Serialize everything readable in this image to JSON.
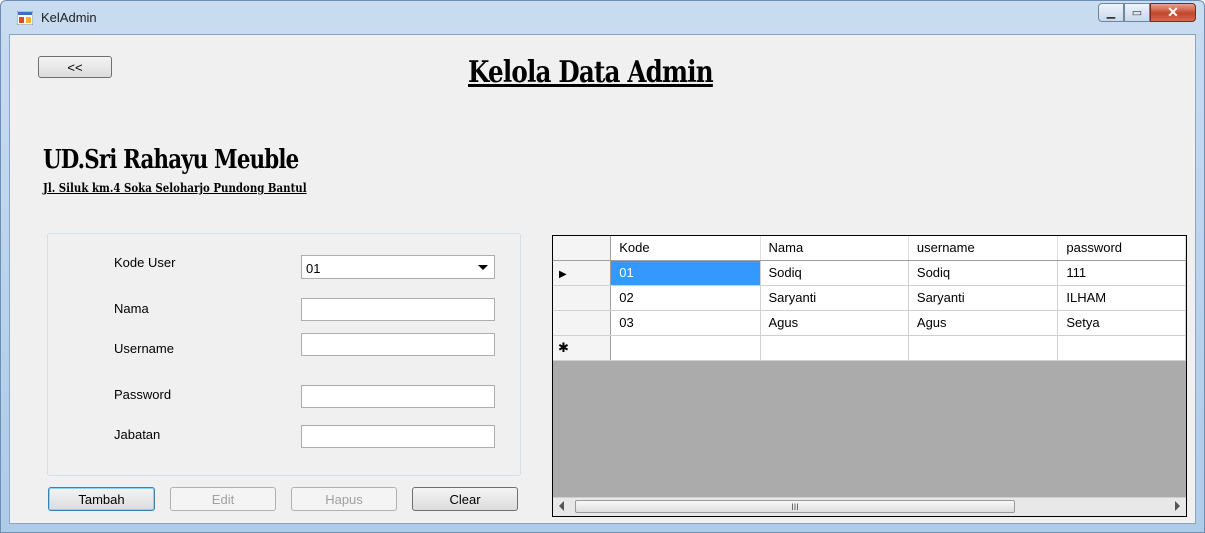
{
  "window": {
    "title": "KelAdmin"
  },
  "nav": {
    "back_label": "<<"
  },
  "heading": "Kelola Data Admin",
  "company": {
    "name": "UD.Sri Rahayu Meuble",
    "address": "Jl. Siluk km.4 Soka Seloharjo Pundong Bantul"
  },
  "form": {
    "kode_user_label": "Kode User",
    "kode_user_value": "01",
    "nama_label": "Nama",
    "nama_value": "",
    "username_label": "Username",
    "username_value": "",
    "password_label": "Password",
    "password_value": "",
    "jabatan_label": "Jabatan",
    "jabatan_value": ""
  },
  "buttons": {
    "tambah": "Tambah",
    "edit": "Edit",
    "hapus": "Hapus",
    "clear": "Clear"
  },
  "grid": {
    "columns": [
      "Kode",
      "Nama",
      "username",
      "password"
    ],
    "rows": [
      [
        "01",
        "Sodiq",
        "Sodiq",
        "111"
      ],
      [
        "02",
        "Saryanti",
        "Saryanti",
        "ILHAM"
      ],
      [
        "03",
        "Agus",
        "Agus",
        "Setya"
      ]
    ],
    "current_row_marker": "▶",
    "new_row_marker": "✱",
    "scroll_thumb_grip": "III"
  },
  "colors": {
    "selection": "#3399ff",
    "grid_background": "#ababab"
  }
}
